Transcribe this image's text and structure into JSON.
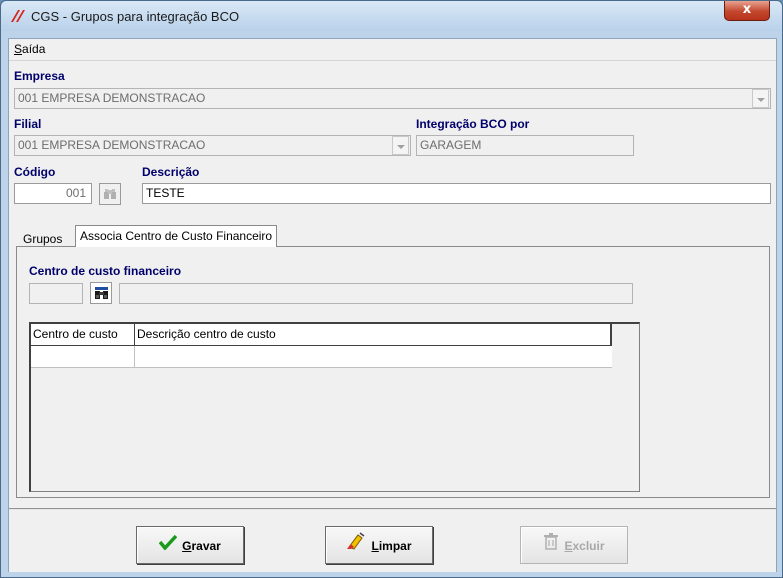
{
  "window": {
    "title": "CGS - Grupos para integração BCO",
    "close_glyph": "x"
  },
  "menu": {
    "items": [
      {
        "label": "Saída",
        "mnemonic": "S",
        "rest": "aída"
      }
    ]
  },
  "form": {
    "empresa": {
      "label": "Empresa",
      "value": "001 EMPRESA DEMONSTRACAO"
    },
    "filial": {
      "label": "Filial",
      "value": "001 EMPRESA DEMONSTRACAO"
    },
    "integracao": {
      "label": "Integração BCO por",
      "value": "GARAGEM"
    },
    "codigo": {
      "label": "Código",
      "value": "001"
    },
    "descricao": {
      "label": "Descrição",
      "value": "TESTE"
    }
  },
  "tabs": [
    {
      "label": "Grupos",
      "active": false
    },
    {
      "label": "Associa Centro de Custo Financeiro",
      "active": true
    }
  ],
  "panel": {
    "centro_label": "Centro de custo financeiro",
    "centro_code": "",
    "centro_desc": ""
  },
  "grid": {
    "columns": [
      "Centro de custo",
      "Descrição centro de custo"
    ],
    "rows": [
      [
        "",
        ""
      ]
    ]
  },
  "buttons": {
    "gravar": {
      "mnemonic": "G",
      "rest": "ravar",
      "enabled": true
    },
    "limpar": {
      "mnemonic": "L",
      "rest": "impar",
      "enabled": true
    },
    "excluir": {
      "mnemonic": "E",
      "rest": "xcluir",
      "enabled": false
    }
  },
  "colors": {
    "label_blue": "#00006b",
    "window_frame": "#bcd3ea",
    "close_red": "#c2482d",
    "check_green": "#1a9a1a"
  },
  "icons": [
    "app-logo-icon",
    "close-icon",
    "binoculars-icon",
    "checkmark-icon",
    "eraser-icon",
    "delete-icon",
    "dropdown-arrow-icon"
  ]
}
